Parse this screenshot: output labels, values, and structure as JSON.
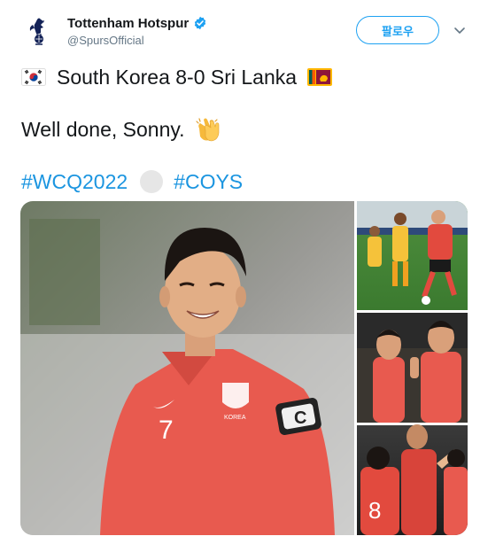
{
  "tweet": {
    "author_name": "Tottenham Hotspur",
    "author_handle": "@SpursOfficial",
    "follow_label": "팔로우",
    "line1_text": "South Korea 8-0 Sri Lanka",
    "line2_text": "Well done, Sonny.",
    "hashtags": [
      "#WCQ2022",
      "#COYS"
    ]
  },
  "photos": {
    "main_player_captain_band": "C",
    "main_player_shirt_number": "7",
    "main_player_crest_text": "KOREA",
    "bottom_right_player_number": "8"
  },
  "icons": {
    "avatar": "spurs-cockerel-logo",
    "verified": "verified-badge-icon",
    "more": "chevron-down-icon",
    "flag_left": "south-korea-flag-icon",
    "flag_right": "sri-lanka-flag-icon",
    "clap": "clapping-hands-emoji"
  },
  "colors": {
    "hashtag": "#1b95e0",
    "follow": "#1da1f2",
    "verified": "#1da1f2",
    "korea_kit": "#e85a4f"
  }
}
